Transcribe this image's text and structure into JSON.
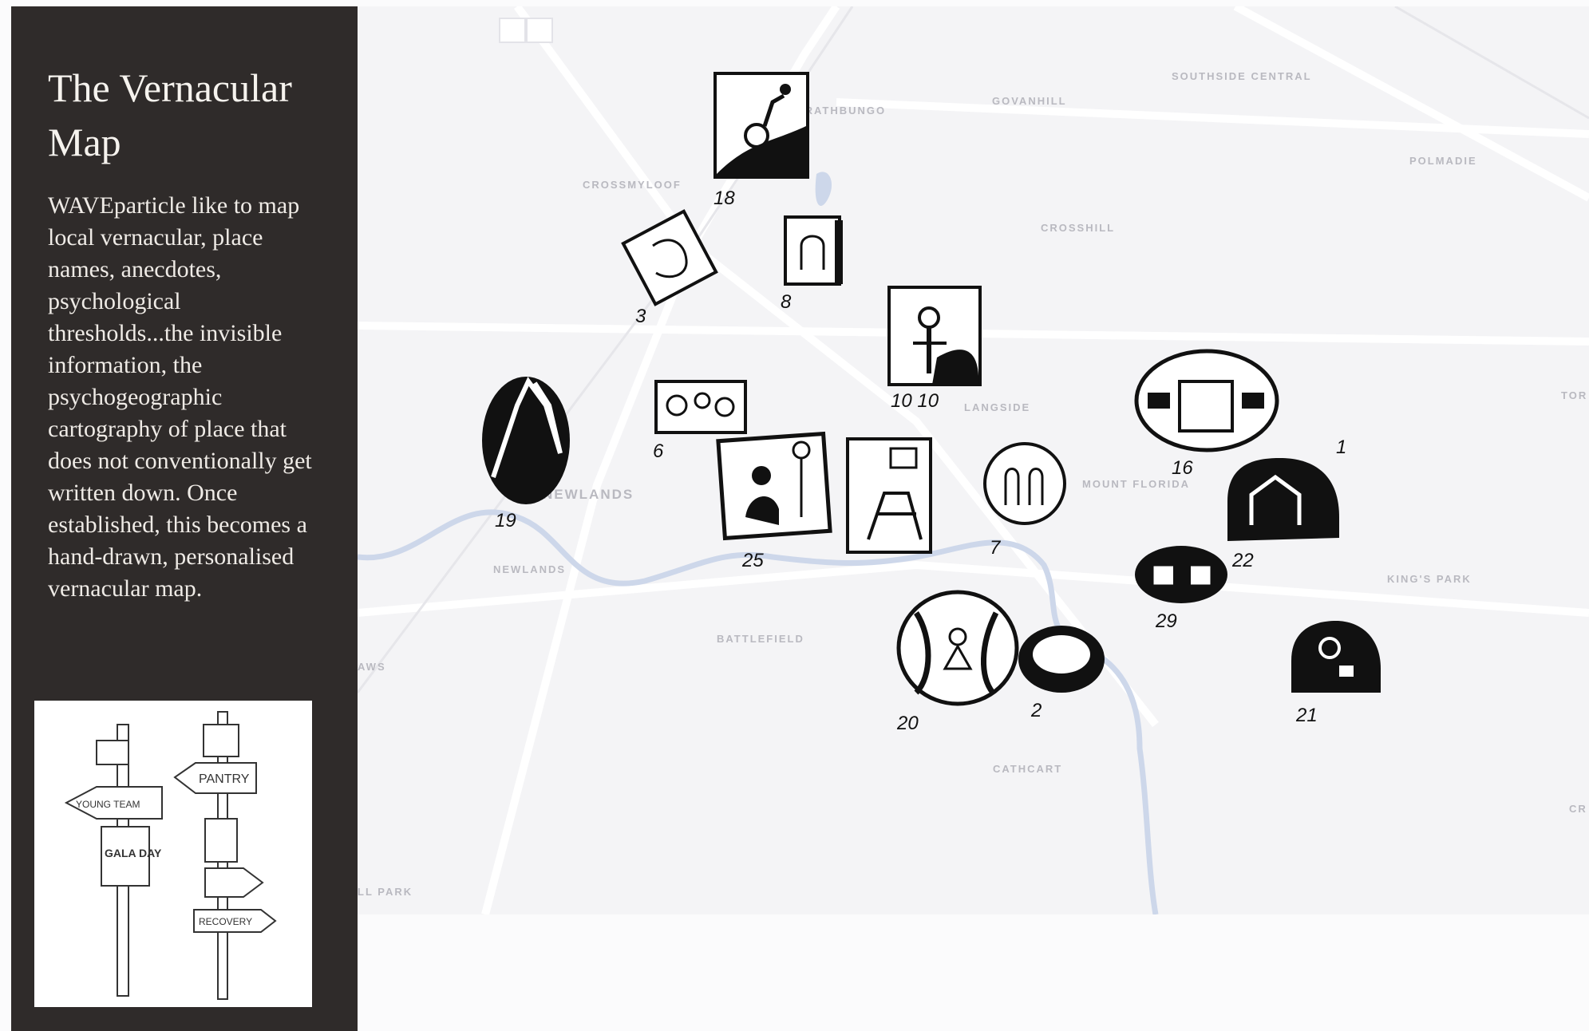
{
  "sidebar": {
    "title": "The Vernacular Map",
    "description": "WAVEparticle like to map local vernacular, place names, anecdotes, psychological thresholds...the invisible information, the psychogeographic cartography of place that does not conventionally get written down. Once established, this becomes a hand-drawn, personalised vernacular map.",
    "illustration": {
      "signs": [
        "YOUNG TEAM",
        "GALA DAY",
        "PANTRY",
        "RECOVERY"
      ]
    }
  },
  "map": {
    "place_labels": [
      "SOUTHSIDE CENTRAL",
      "STRATHBUNGO",
      "GOVANHILL",
      "POLMADIE",
      "CROSSMYLOOF",
      "CROSSHILL",
      "LANGSIDE",
      "MOUNT FLORIDA",
      "NEWLANDS",
      "NEWLANDS",
      "BATTLEFIELD",
      "KING'S PARK",
      "CATHCART",
      "TOR",
      "CR",
      "AWS",
      "LL PARK"
    ],
    "markers": [
      {
        "label": "18",
        "icon": "wheelchair-rider-icon"
      },
      {
        "label": "3",
        "icon": "faces-icon"
      },
      {
        "label": "8",
        "icon": "doorway-icon"
      },
      {
        "label": "10 10",
        "icon": "lamp-figure-icon"
      },
      {
        "label": "6",
        "icon": "people-group-icon"
      },
      {
        "label": "19",
        "icon": "mountain-icon"
      },
      {
        "label": "25",
        "icon": "reading-people-icon"
      },
      {
        "label": "easel",
        "icon": "easel-icon"
      },
      {
        "label": "7",
        "icon": "arched-windows-icon"
      },
      {
        "label": "16",
        "icon": "train-icon"
      },
      {
        "label": "1",
        "icon": "house-icon"
      },
      {
        "label": "22",
        "icon": "house-icon"
      },
      {
        "label": "29",
        "icon": "belt-icon"
      },
      {
        "label": "20",
        "icon": "tree-figure-icon"
      },
      {
        "label": "2",
        "icon": "basin-icon"
      },
      {
        "label": "21",
        "icon": "person-badge-icon"
      }
    ]
  }
}
